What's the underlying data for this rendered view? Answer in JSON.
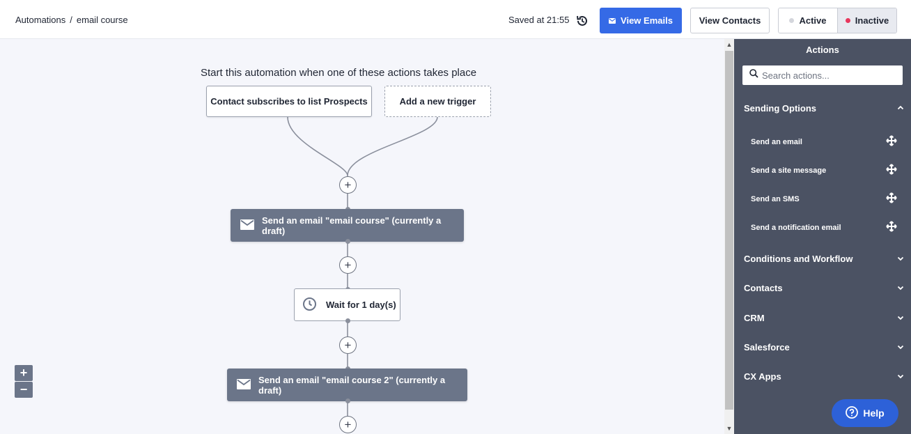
{
  "header": {
    "breadcrumb_root": "Automations",
    "breadcrumb_sep": "/",
    "breadcrumb_current": "email course",
    "saved_text": "Saved at 21:55",
    "view_emails_label": "View Emails",
    "view_contacts_label": "View Contacts",
    "active_label": "Active",
    "inactive_label": "Inactive",
    "status_selected": "Inactive"
  },
  "canvas": {
    "trigger_heading": "Start this automation when one of these actions takes place",
    "trigger_label": "Contact subscribes to list Prospects",
    "add_trigger_label": "Add a new trigger",
    "steps": [
      {
        "type": "email",
        "label": "Send an email \"email course\" (currently a draft)"
      },
      {
        "type": "wait",
        "label": "Wait for 1 day(s)"
      },
      {
        "type": "email",
        "label": "Send an email \"email course 2\" (currently a draft)"
      }
    ],
    "zoom_in_label": "+",
    "zoom_out_label": "−"
  },
  "sidebar": {
    "title": "Actions",
    "search_placeholder": "Search actions...",
    "sections": [
      {
        "label": "Sending Options",
        "expanded": true,
        "items": [
          "Send an email",
          "Send a site message",
          "Send an SMS",
          "Send a notification email"
        ]
      },
      {
        "label": "Conditions and Workflow",
        "expanded": false
      },
      {
        "label": "Contacts",
        "expanded": false
      },
      {
        "label": "CRM",
        "expanded": false
      },
      {
        "label": "Salesforce",
        "expanded": false
      },
      {
        "label": "CX Apps",
        "expanded": false
      }
    ]
  },
  "help": {
    "label": "Help"
  },
  "colors": {
    "primary_button": "#356ae6",
    "email_node": "#6b7589",
    "sidebar_bg": "#4b5263",
    "canvas_bg": "#f5f6fb",
    "inactive_dot": "#e8365c",
    "active_dot": "#d4d6dc",
    "help_button": "#2d61d8"
  },
  "icons": {
    "history": "history-icon",
    "mail": "envelope-icon",
    "clock": "clock-icon",
    "search": "search-icon",
    "drag": "move-icon",
    "chevron_up": "chevron-up-icon",
    "chevron_down": "chevron-down-icon",
    "help": "question-icon"
  }
}
